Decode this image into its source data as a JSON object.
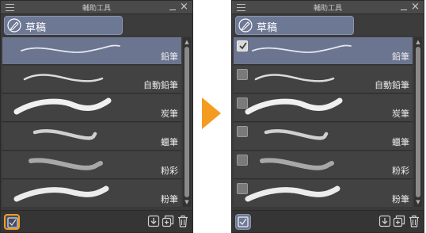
{
  "colors": {
    "highlight": "#f39c1f",
    "selected": "#6c7590",
    "arrow": "#f39c1f"
  },
  "panels": [
    {
      "title": "輔助工具",
      "tab_label": "草稿",
      "show_checkboxes": false,
      "bottom_toggle_icon": "show-checkbox-icon",
      "bottom_toggle_state": "highlighted",
      "items": [
        {
          "label": "鉛筆",
          "selected": true,
          "checked": false,
          "stroke": "pencil"
        },
        {
          "label": "自動鉛筆",
          "selected": false,
          "checked": false,
          "stroke": "mechanical-pencil"
        },
        {
          "label": "炭筆",
          "selected": false,
          "checked": false,
          "stroke": "charcoal"
        },
        {
          "label": "蠟筆",
          "selected": false,
          "checked": false,
          "stroke": "crayon"
        },
        {
          "label": "粉彩",
          "selected": false,
          "checked": false,
          "stroke": "pastel"
        },
        {
          "label": "粉筆",
          "selected": false,
          "checked": false,
          "stroke": "chalk"
        }
      ]
    },
    {
      "title": "輔助工具",
      "tab_label": "草稿",
      "show_checkboxes": true,
      "bottom_toggle_icon": "show-checkbox-icon",
      "bottom_toggle_state": "active",
      "items": [
        {
          "label": "鉛筆",
          "selected": true,
          "checked": true,
          "stroke": "pencil"
        },
        {
          "label": "自動鉛筆",
          "selected": false,
          "checked": false,
          "stroke": "mechanical-pencil"
        },
        {
          "label": "炭筆",
          "selected": false,
          "checked": false,
          "stroke": "charcoal"
        },
        {
          "label": "蠟筆",
          "selected": false,
          "checked": false,
          "stroke": "crayon"
        },
        {
          "label": "粉彩",
          "selected": false,
          "checked": false,
          "stroke": "pastel"
        },
        {
          "label": "粉筆",
          "selected": false,
          "checked": false,
          "stroke": "chalk"
        }
      ]
    }
  ],
  "bottom_icons": [
    "download-icon",
    "duplicate-icon",
    "trash-icon"
  ],
  "arrow_icon": "arrow-right-icon"
}
